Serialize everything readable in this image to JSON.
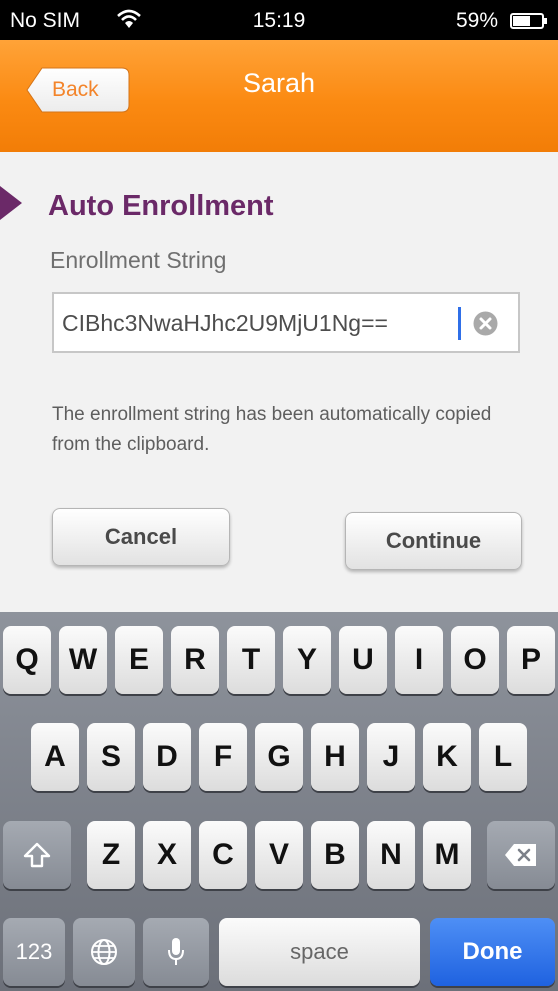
{
  "status_bar": {
    "carrier": "No SIM",
    "time": "15:19",
    "battery": "59%"
  },
  "nav": {
    "back_label": "Back",
    "title": "Sarah"
  },
  "section": {
    "title": "Auto Enrollment",
    "field_label": "Enrollment String",
    "field_value": "CIBhc3NwaHJhc2U9MjU1Ng==",
    "hint": "The enrollment string has been automatically copied from the clipboard."
  },
  "buttons": {
    "cancel": "Cancel",
    "continue": "Continue"
  },
  "keyboard": {
    "row1": [
      "Q",
      "W",
      "E",
      "R",
      "T",
      "Y",
      "U",
      "I",
      "O",
      "P"
    ],
    "row2": [
      "A",
      "S",
      "D",
      "F",
      "G",
      "H",
      "J",
      "K",
      "L"
    ],
    "row3": [
      "Z",
      "X",
      "C",
      "V",
      "B",
      "N",
      "M"
    ],
    "numbers": "123",
    "space": "space",
    "done": "Done",
    "icons": [
      "shift-icon",
      "backspace-icon",
      "globe-icon",
      "microphone-icon"
    ]
  },
  "colors": {
    "nav_orange": "#fb8a12",
    "section_purple": "#6b2968",
    "done_blue": "#1f62e0"
  }
}
